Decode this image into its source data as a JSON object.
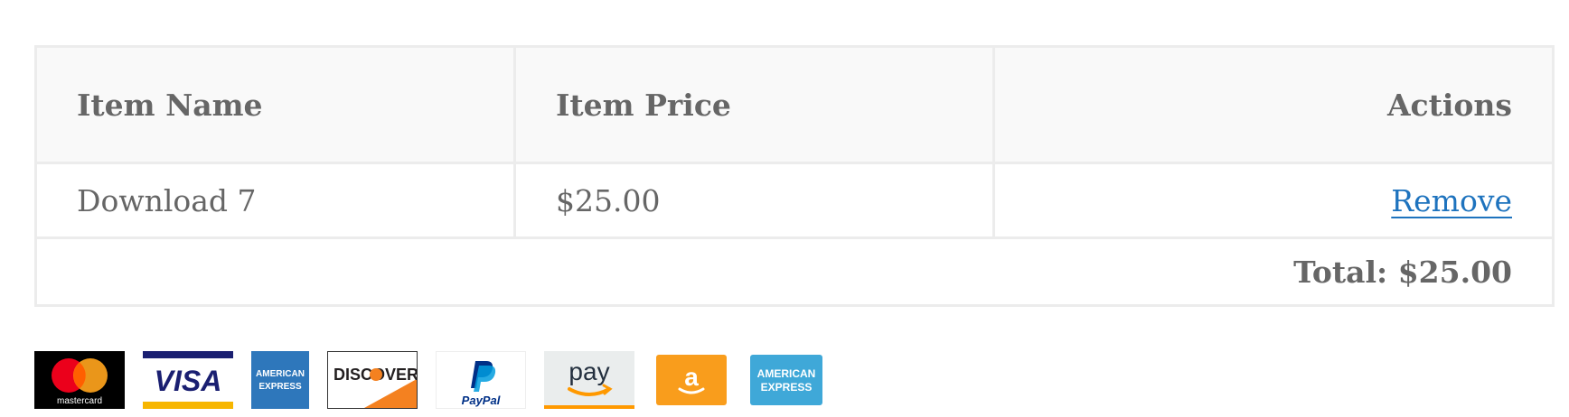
{
  "cart_table": {
    "headers": {
      "item_name": "Item Name",
      "item_price": "Item Price",
      "actions": "Actions"
    },
    "rows": [
      {
        "name": "Download 7",
        "price": "$25.00",
        "action_label": "Remove"
      }
    ],
    "total_label": "Total: $25.00"
  },
  "payment_icons": [
    {
      "icon": "mastercard-icon",
      "label": "mastercard"
    },
    {
      "icon": "visa-icon",
      "label": "VISA"
    },
    {
      "icon": "american-express-icon",
      "label": "AMERICAN EXPRESS"
    },
    {
      "icon": "discover-icon",
      "label": "DISCOVER"
    },
    {
      "icon": "paypal-icon",
      "label": "PayPal"
    },
    {
      "icon": "amazon-pay-icon",
      "label": "pay"
    },
    {
      "icon": "amazon-icon",
      "label": "a"
    },
    {
      "icon": "american-express-icon",
      "label": "AMERICAN EXPRESS"
    }
  ],
  "colors": {
    "link": "#1e73be",
    "text": "#666666",
    "header_bg": "#f9f9f9",
    "border": "#ececec"
  }
}
